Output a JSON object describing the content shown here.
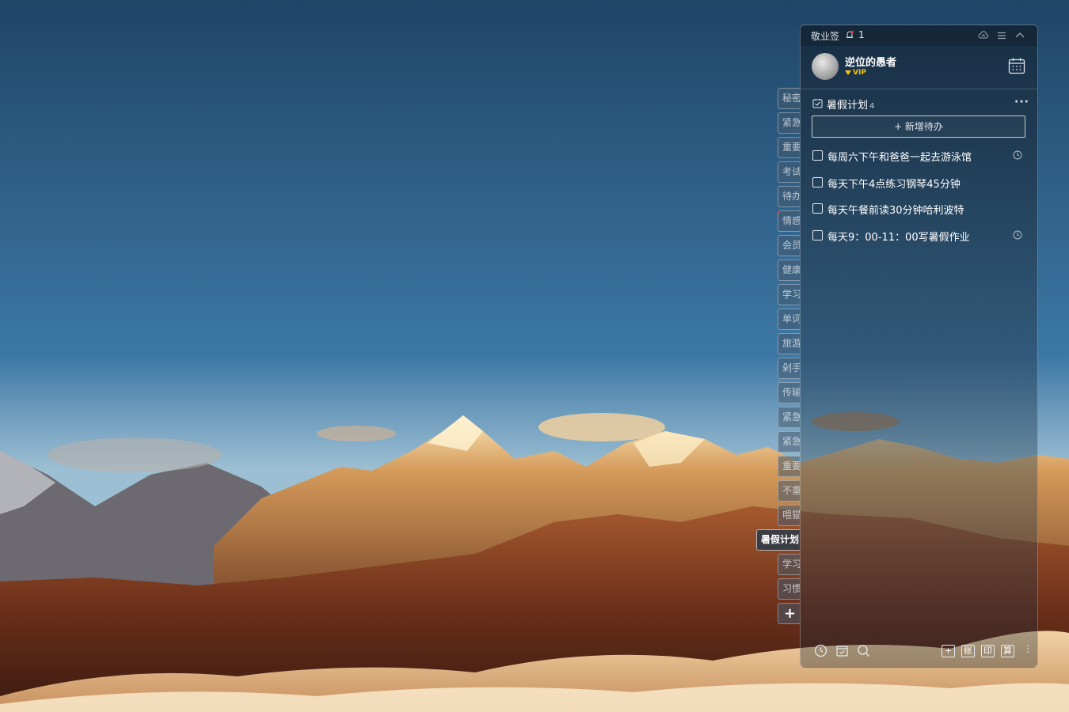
{
  "app": {
    "name": "敬业签",
    "notification_count": "1"
  },
  "user": {
    "name": "逆位的愚者",
    "badge": "VIP"
  },
  "tabs": [
    "秘密",
    "紧急",
    "重要",
    "考试",
    "待办",
    "情感",
    "会员",
    "健康",
    "学习",
    "单词",
    "旅游",
    "剁手",
    "传输",
    "紧急",
    "紧急",
    "重要",
    "不重",
    "喂猫",
    "暑假计划",
    "学习",
    "习惯"
  ],
  "active_tab_index": 18,
  "add_tab_label": "+",
  "list": {
    "title": "暑假计划",
    "count": "4",
    "more_label": "···"
  },
  "add_todo_label": "+ 新增待办",
  "todos": [
    {
      "text": "每周六下午和爸爸一起去游泳馆",
      "has_reminder": true
    },
    {
      "text": "每天下午4点练习钢琴45分钟",
      "has_reminder": false
    },
    {
      "text": "每天午餐前读30分钟哈利波特",
      "has_reminder": false
    },
    {
      "text": "每天9：00-11：00写暑假作业",
      "has_reminder": true
    }
  ],
  "bottom_buttons": [
    "+",
    "账",
    "印",
    "算"
  ],
  "bottom_more": "⋮",
  "colors": {
    "vip": "#f5c518",
    "unread_dot": "#e33333",
    "text": "#ffffff"
  }
}
